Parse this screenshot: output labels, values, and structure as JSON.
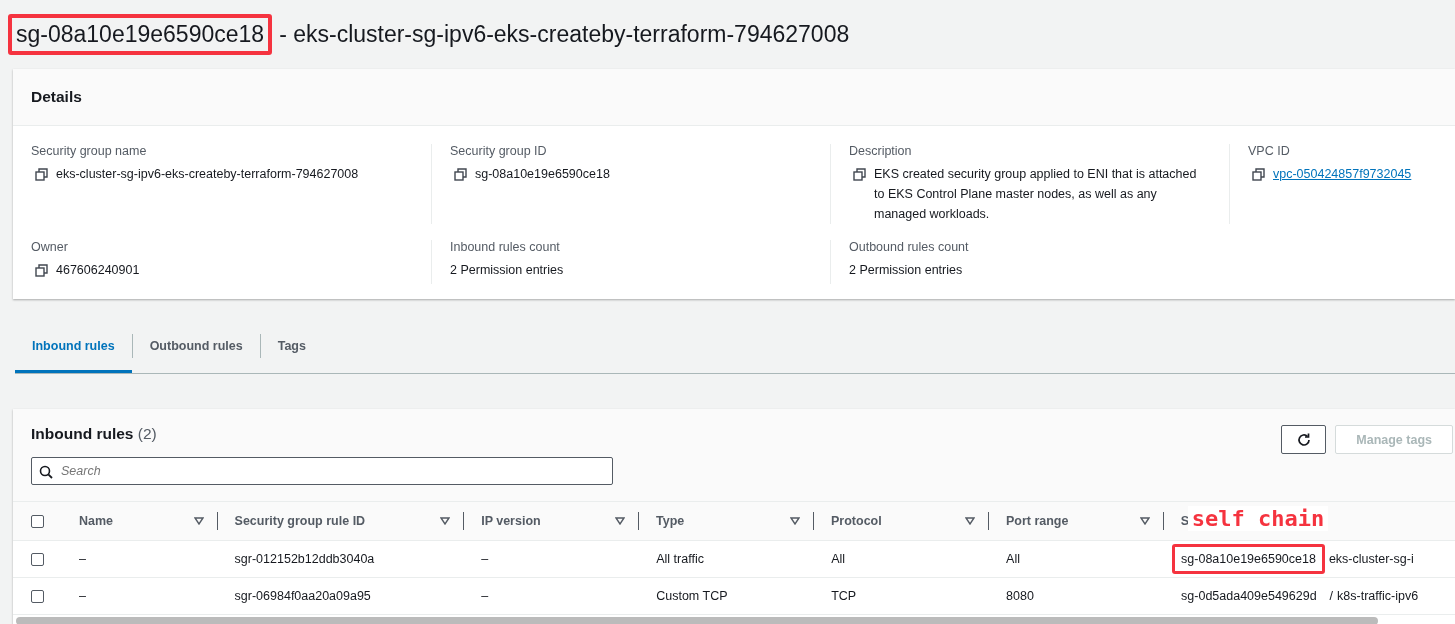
{
  "title": {
    "id": "sg-08a10e19e6590ce18",
    "rest": "- eks-cluster-sg-ipv6-eks-createby-terraform-794627008",
    "highlighted": true
  },
  "details": {
    "heading": "Details",
    "fields": [
      {
        "label": "Security group name",
        "value": "eks-cluster-sg-ipv6-eks-createby-terraform-794627008",
        "copy": true,
        "kind": "text"
      },
      {
        "label": "Security group ID",
        "value": "sg-08a10e19e6590ce18",
        "copy": true,
        "kind": "text"
      },
      {
        "label": "Description",
        "value": "EKS created security group applied to ENI that is attached to EKS Control Plane master nodes, as well as any managed workloads.",
        "copy": true,
        "kind": "text"
      },
      {
        "label": "VPC ID",
        "value": "vpc-050424857f9732045",
        "copy": true,
        "kind": "link"
      },
      {
        "label": "Owner",
        "value": "467606240901",
        "copy": true,
        "kind": "text"
      },
      {
        "label": "Inbound rules count",
        "value": "2 Permission entries",
        "copy": false,
        "kind": "text"
      },
      {
        "label": "Outbound rules count",
        "value": "2 Permission entries",
        "copy": false,
        "kind": "text"
      }
    ]
  },
  "tabs": [
    {
      "label": "Inbound rules",
      "selected": true
    },
    {
      "label": "Outbound rules",
      "selected": false
    },
    {
      "label": "Tags",
      "selected": false
    }
  ],
  "rules_panel": {
    "heading": "Inbound rules",
    "count": "(2)",
    "manage_tags": {
      "label": "Manage tags",
      "disabled": true
    },
    "search": {
      "placeholder": "Search"
    },
    "all_selected": false,
    "columns": [
      "Name",
      "Security group rule ID",
      "IP version",
      "Type",
      "Protocol",
      "Port range",
      "S"
    ],
    "rows": [
      {
        "selected": false,
        "cells": [
          "–",
          "sgr-012152b12ddb3040a",
          "–",
          "All traffic",
          "All",
          "All"
        ],
        "source": {
          "id": "sg-08a10e19e6590ce18",
          "name": "eks-cluster-sg-i",
          "highlighted": true
        }
      },
      {
        "selected": false,
        "cells": [
          "–",
          "sgr-06984f0aa20a09a95",
          "–",
          "Custom TCP",
          "TCP",
          "8080"
        ],
        "source": {
          "id": "sg-0d5ada409e549629d",
          "separator": "/",
          "name": "k8s-traffic-ipv6",
          "highlighted": false
        }
      }
    ]
  },
  "annotation": {
    "label": "self chain"
  }
}
